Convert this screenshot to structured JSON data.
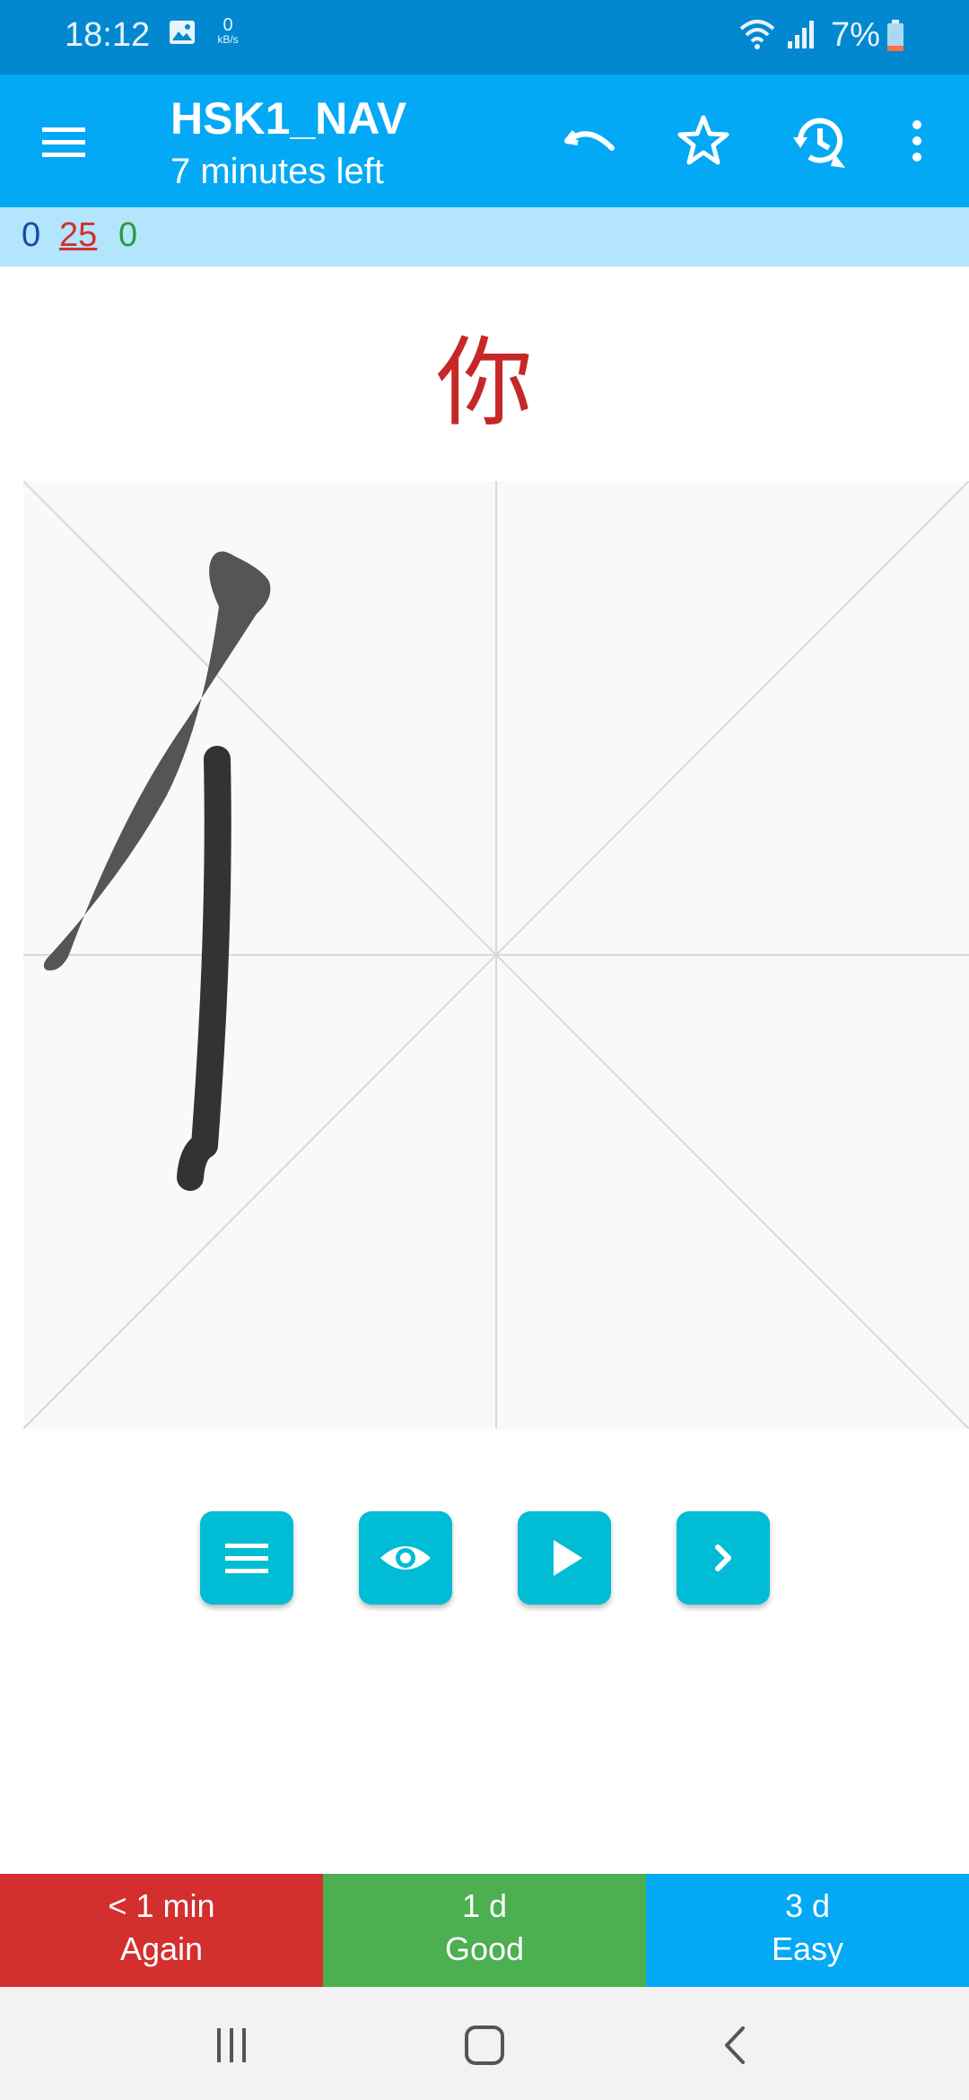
{
  "status_bar": {
    "time": "18:12",
    "data_rate_value": "0",
    "data_rate_unit": "kB/s",
    "battery_percent": "7%",
    "icons": [
      "image-icon",
      "wifi-icon",
      "signal-icon",
      "battery-icon"
    ]
  },
  "app_bar": {
    "title": "HSK1_NAV",
    "subtitle": "7 minutes left",
    "icons": [
      "menu-icon",
      "undo-icon",
      "star-icon",
      "history-icon",
      "more-vert-icon"
    ]
  },
  "counts": {
    "new": "0",
    "learning": "25",
    "review": "0",
    "colors": {
      "new": "#1a47a6",
      "learning": "#d32f2f",
      "review": "#2e9a3a"
    }
  },
  "card": {
    "character": "你",
    "character_color": "#c62828"
  },
  "tools": [
    "list-icon",
    "eye-icon",
    "play-icon",
    "chevron-right-icon"
  ],
  "rating": {
    "again_interval": "< 1 min",
    "again_label": "Again",
    "good_interval": "1 d",
    "good_label": "Good",
    "easy_interval": "3 d",
    "easy_label": "Easy",
    "colors": {
      "again": "#d32f2f",
      "good": "#4caf50",
      "easy": "#03a9f4"
    }
  },
  "nav_bar": {
    "icons": [
      "recents-icon",
      "home-icon",
      "back-icon"
    ]
  },
  "colors": {
    "status_bar": "#0288d1",
    "app_bar": "#03a9f4",
    "counts_bar": "#b3e5fc",
    "tool_button": "#00bcd4"
  }
}
